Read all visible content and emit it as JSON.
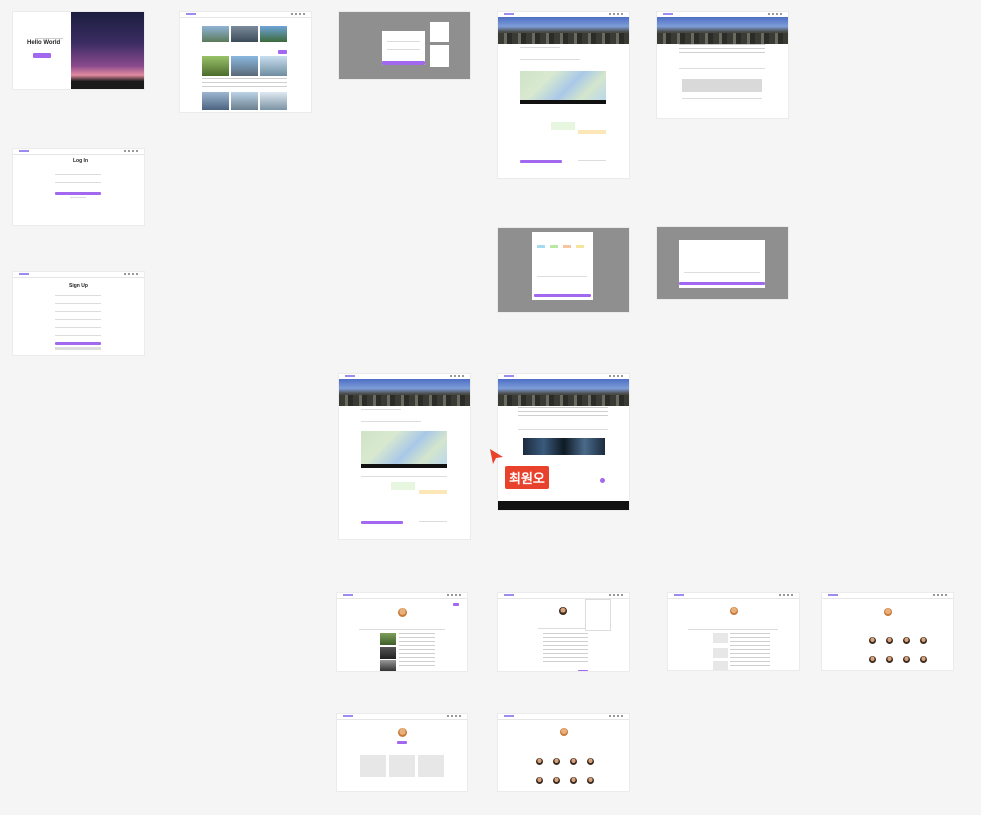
{
  "canvas": {
    "background": "#f5f5f5",
    "accent": "#a368f0"
  },
  "frames": {
    "home": {
      "heading": "Hello World"
    },
    "login": {
      "heading": "Log In"
    },
    "signup": {
      "heading": "Sign Up"
    }
  },
  "annotation": {
    "label": "최원오",
    "cursor_icon": "cursor-arrow-icon"
  }
}
